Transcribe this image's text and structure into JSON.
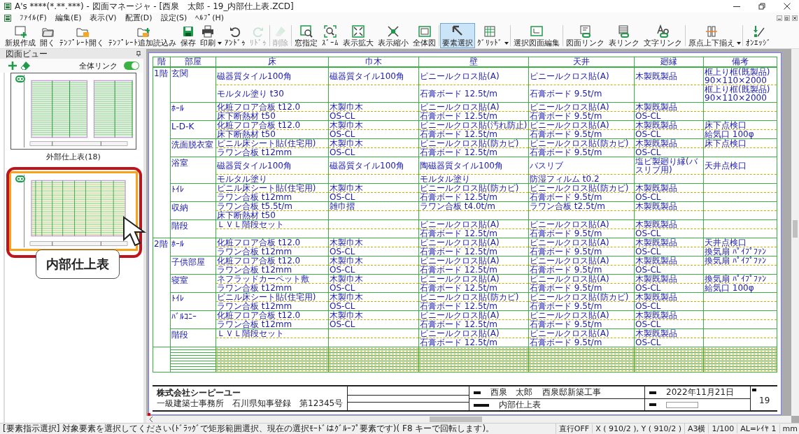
{
  "window": {
    "title": "A's ****(*.**.***) - 図面マネージャ - [西泉　太郎 - 19_内部仕上表.ZCD]"
  },
  "menu": [
    "ﾌｧｲﾙ(F)",
    "編集(E)",
    "表示(V)",
    "配置(D)",
    "設定(S)",
    "ﾍﾙﾌﾟ(H)"
  ],
  "toolbar": {
    "groups": [
      [
        {
          "label": "新規作成",
          "selected": false,
          "disabled": false,
          "dropdown": false
        },
        {
          "label": "開く",
          "selected": false,
          "disabled": false,
          "dropdown": false
        },
        {
          "label": "ﾃﾝﾌﾟﾚｰﾄ開く",
          "selected": false,
          "disabled": false,
          "dropdown": false
        },
        {
          "label": "ﾃﾝﾌﾟﾚｰﾄ追加読込み",
          "selected": false,
          "disabled": false,
          "dropdown": false
        },
        {
          "label": "保存",
          "selected": false,
          "disabled": false,
          "dropdown": false
        },
        {
          "label": "印刷",
          "selected": false,
          "disabled": false,
          "dropdown": true
        },
        {
          "label": "ｱﾝﾄﾞｩ",
          "selected": false,
          "disabled": false,
          "dropdown": false
        },
        {
          "label": "ﾘﾄﾞｩ",
          "selected": false,
          "disabled": true,
          "dropdown": false
        }
      ],
      [
        {
          "label": "削除",
          "selected": false,
          "disabled": true,
          "dropdown": false
        }
      ],
      [
        {
          "label": "窓指定",
          "selected": false,
          "disabled": false,
          "dropdown": false
        },
        {
          "label": "ｽﾞｰﾑ",
          "selected": false,
          "disabled": false,
          "dropdown": false
        },
        {
          "label": "表示拡大",
          "selected": false,
          "disabled": false,
          "dropdown": false
        },
        {
          "label": "表示縮小",
          "selected": false,
          "disabled": false,
          "dropdown": false
        },
        {
          "label": "全体図",
          "selected": false,
          "disabled": false,
          "dropdown": false
        }
      ],
      [
        {
          "label": "要素選択",
          "selected": true,
          "disabled": false,
          "dropdown": false
        },
        {
          "label": "ｸﾞﾘｯﾄﾞ",
          "selected": false,
          "disabled": false,
          "dropdown": true
        }
      ],
      [
        {
          "label": "選択図面編集",
          "selected": false,
          "disabled": false,
          "dropdown": false
        }
      ],
      [
        {
          "label": "図面リンク",
          "selected": false,
          "disabled": false,
          "dropdown": false
        },
        {
          "label": "表リンク",
          "selected": false,
          "disabled": false,
          "dropdown": false
        },
        {
          "label": "文字リンク",
          "selected": false,
          "disabled": false,
          "dropdown": false
        }
      ],
      [
        {
          "label": "原点上下揃え",
          "selected": false,
          "disabled": false,
          "dropdown": true
        }
      ],
      [
        {
          "label": "ｵﾝｴｯｼﾞ",
          "selected": false,
          "disabled": false,
          "dropdown": false
        }
      ]
    ]
  },
  "sidebar": {
    "title": "図面ビュー",
    "link_all": {
      "label": "全体リンク",
      "on": true
    },
    "thumbnails": [
      {
        "label": "外部仕上表(18)",
        "selected": false,
        "highlighted": false,
        "kind": "exterior"
      },
      {
        "selected": true,
        "highlighted": true,
        "kind": "interior"
      }
    ],
    "callout": {
      "text": "内部仕上表"
    }
  },
  "drawing": {
    "table": {
      "columns": [
        "階",
        "部屋",
        "床",
        "巾木",
        "壁",
        "天井",
        "廻縁",
        "備考"
      ],
      "floors": [
        {
          "floor": "1階",
          "rooms": [
            {
              "room": "玄関",
              "cells": [
                [
                  "磁器質タイル100角",
                  "モルタル塗り t30"
                ],
                [
                  "磁器質タイル100角"
                ],
                [
                  "ビニールクロス貼(A)",
                  "石膏ボード 12.5t/m"
                ],
                [
                  "ビニールクロス貼(A)",
                  "石膏ボード 9.5t/m"
                ],
                [
                  "木製既製品"
                ],
                [
                  "框上り框(既製品) 90×110×2000",
                  "框上り框(既製品) 90×110×2000"
                ]
              ]
            },
            {
              "room": "ﾎｰﾙ",
              "cells": [
                [
                  "化粧フロア合板 t12.0",
                  "床下断熱材 t50"
                ],
                [
                  "木製巾木",
                  "OS-CL"
                ],
                [
                  "ビニールクロス貼(A)",
                  "石膏ボード 12.5t/m"
                ],
                [
                  "ビニールクロス貼(A)",
                  "石膏ボード 9.5t/m"
                ],
                [
                  "木製既製品",
                  "OS-CL"
                ],
                null
              ]
            },
            {
              "room": "L-D-K",
              "cells": [
                [
                  "化粧フロア合板 t12.0",
                  "床下断熱材 t50"
                ],
                [
                  "木製巾木",
                  "OS-CL"
                ],
                [
                  "ビニールクロス貼(汚れ防止)",
                  "石膏ボード 12.5t/m"
                ],
                [
                  "ビニールクロス貼(A)",
                  "石膏ボード 9.5t/m"
                ],
                [
                  "木製既製品",
                  "OS-CL"
                ],
                [
                  "床下点検口",
                  "給気口 100φ"
                ]
              ]
            },
            {
              "room": "洗面脱衣室",
              "cells": [
                [
                  "ビニル床シート貼(住宅用)",
                  "ラワン合板 t12mm"
                ],
                [
                  "木製巾木",
                  "OS-CL"
                ],
                [
                  "ビニールクロス貼(防カビ)",
                  "石膏ボード 12.5t/m"
                ],
                [
                  "ビニールクロス貼(防カビ)",
                  "石膏ボード 9.5t/m"
                ],
                [
                  "木製既製品",
                  "OS-CL"
                ],
                [
                  "床下点検口"
                ]
              ]
            },
            {
              "room": "浴室",
              "cells": [
                [
                  "磁器質タイル100角",
                  "モルタル塗り"
                ],
                [
                  "磁器質タイル100角"
                ],
                [
                  "陶磁器質タイル100角",
                  "モルタル塗り"
                ],
                [
                  "バスリブ",
                  "防湿フィルム t0.2"
                ],
                [
                  "塩ビ製廻り縁(バスリブ用)"
                ],
                [
                  "天井点検口"
                ]
              ]
            },
            {
              "room": "ﾄｲﾚ",
              "cells": [
                [
                  "ビニル床シート貼(住宅用)",
                  "ラワン合板 t12mm"
                ],
                [
                  "木製巾木",
                  "OS-CL"
                ],
                [
                  "ビニールクロス貼(防カビ)",
                  "石膏ボード 12.5t/m"
                ],
                [
                  "ビニールクロス貼(防カビ)",
                  "石膏ボード 9.5t/m"
                ],
                [
                  "木製既製品",
                  "OS-CL"
                ],
                null
              ]
            },
            {
              "room": "収納",
              "cells": [
                [
                  "ラワン合板 t5.5t/m",
                  "床下断熱材 t50"
                ],
                [
                  "雑巾摺"
                ],
                [
                  "ラワン合板 t4.0t/m"
                ],
                [
                  "ラワン合板 t2.5t/m"
                ],
                [
                  "木製既製品"
                ],
                null
              ]
            },
            {
              "room": "階段",
              "cells": [
                [
                  "ＬＶＬ階段セット"
                ],
                null,
                [
                  "ビニールクロス貼(A)",
                  "石膏ボード 12.5t/m"
                ],
                [
                  "ビニールクロス貼(A)",
                  "石膏ボード 9.5t/m"
                ],
                [
                  "木製既製品",
                  "OS-CL"
                ],
                null
              ]
            }
          ]
        },
        {
          "floor": "2階",
          "rooms": [
            {
              "room": "ﾎｰﾙ",
              "cells": [
                [
                  "化粧フロア合板 t12.0",
                  "ラワン合板 t12mm"
                ],
                [
                  "木製巾木",
                  "OS-CL"
                ],
                [
                  "ビニールクロス貼(A)",
                  "石膏ボード 12.5t/m"
                ],
                [
                  "ビニールクロス貼(A)",
                  "石膏ボード 9.5t/m"
                ],
                [
                  "木製既製品",
                  "OS-CL"
                ],
                [
                  "天井点検口",
                  "換気扇 ﾊﾟｲﾌﾟﾌｧﾝ"
                ]
              ]
            },
            {
              "room": "子供部屋",
              "cells": [
                [
                  "化粧フロア合板 t12.0",
                  "ラワン合板 t12mm"
                ],
                [
                  "木製巾木",
                  "OS-CL"
                ],
                [
                  "ビニールクロス貼(A)",
                  "石膏ボード 12.5t/m"
                ],
                [
                  "ビニールクロス貼(A)",
                  "石膏ボード 9.5t/m"
                ],
                [
                  "木製既製品",
                  "OS-CL"
                ],
                [
                  "換気扇 ﾊﾟｲﾌﾟﾌｧﾝ"
                ]
              ]
            },
            {
              "room": "寝室",
              "cells": [
                [
                  "ネフラッドカーペット敷",
                  "ラワン合板 t12mm"
                ],
                [
                  "木製巾木",
                  "OS-CL"
                ],
                [
                  "ビニールクロス貼(A)",
                  "石膏ボード 12.5t/m"
                ],
                [
                  "ビニールクロス貼(A)",
                  "石膏ボード 9.5t/m"
                ],
                [
                  "木製既製品",
                  "OS-CL"
                ],
                [
                  "換気扇 ﾊﾟｲﾌﾟﾌｧﾝ",
                  "給気口 100φ"
                ]
              ]
            },
            {
              "room": "ﾄｲﾚ",
              "cells": [
                [
                  "ビニル床シート貼(住宅用)",
                  "ラワン合板 t12mm"
                ],
                [
                  "木製巾木",
                  "OS-CL"
                ],
                [
                  "ビニールクロス貼(防カビ)",
                  "石膏ボード 12.5t/m"
                ],
                [
                  "ビニールクロス貼(防カビ)",
                  "石膏ボード 9.5t/m"
                ],
                [
                  "木製既製品",
                  "OS-CL"
                ],
                null
              ]
            },
            {
              "room": "ﾊﾞﾙｺﾆｰ",
              "cells": [
                [
                  "化粧フロア合板 t12.0",
                  "ラワン合板 t12mm"
                ],
                [
                  "木製巾木",
                  "OS-CL"
                ],
                [
                  "ビニールクロス貼(A)",
                  "石膏ボード 12.5t/m"
                ],
                [
                  "ビニールクロス貼(A)",
                  "石膏ボード 9.5t/m"
                ],
                [
                  "木製既製品",
                  "OS-CL"
                ],
                null
              ]
            },
            {
              "room": "階段",
              "cells": [
                [
                  "ＬＶＬ階段セット"
                ],
                null,
                [
                  "ビニールクロス貼(A)",
                  "石膏ボード 12.5t/m"
                ],
                [
                  "ビニールクロス貼(A)",
                  "石膏ボード 9.5t/m"
                ],
                [
                  "木製既製品",
                  "OS-CL"
                ],
                null
              ]
            }
          ]
        }
      ]
    },
    "title_block": {
      "company": "株式会社シーピーユー",
      "company_note": "一級建築士事務所　石川県知事登録　第12345号",
      "client": "西泉　太郎",
      "project": "西泉邸新築工事",
      "date": "2022年11月21日",
      "drawing_name": "内部仕上表",
      "sheet": "19"
    }
  },
  "status_bar": {
    "message": "[要素指示選択]  対象要素を選択してください(ﾄﾞﾗｯｸﾞで矩形範囲選択、現在の選択ﾓｰﾄﾞはｸﾞﾙｰﾌﾟ要素です)( F8 キーで回転します)。",
    "fields": [
      "直行OFF",
      "X ( 910/2 ), Y ( 910/2 )",
      "A3横",
      "1/100",
      "AL=ﾚｲﾔ 1",
      "mm"
    ]
  }
}
